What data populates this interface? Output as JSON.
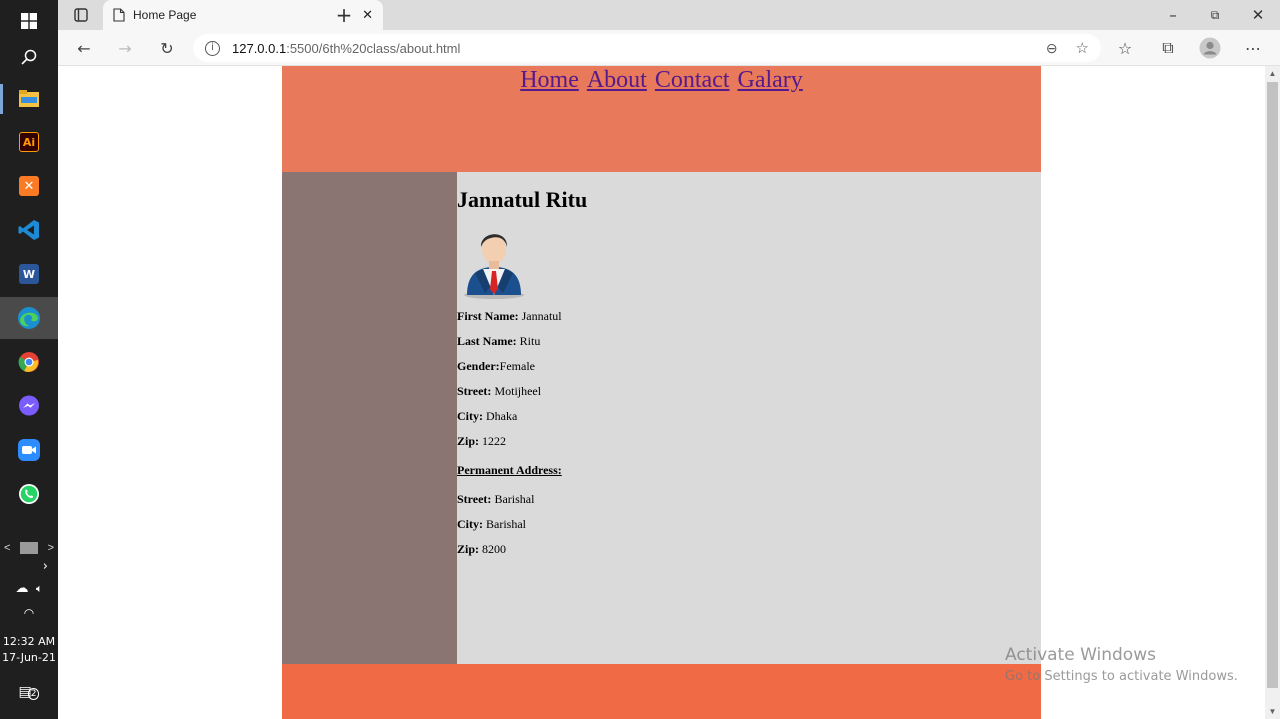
{
  "taskbar": {
    "items": [
      {
        "name": "windows-start",
        "color": "#ffffff"
      },
      {
        "name": "search",
        "color": "#ffffff"
      },
      {
        "name": "file-explorer",
        "color": "#f4c242"
      },
      {
        "name": "adobe-illustrator",
        "label": "Ai",
        "color": "#ff7c00"
      },
      {
        "name": "xampp",
        "color": "#fb7a24"
      },
      {
        "name": "vs-code",
        "color": "#1e8ad6"
      },
      {
        "name": "ms-word",
        "label": "W",
        "color": "#2b579a"
      },
      {
        "name": "edge",
        "color": "#2fa3d9"
      },
      {
        "name": "chrome",
        "color": "#e44134"
      },
      {
        "name": "messenger",
        "color": "#7a5cff"
      },
      {
        "name": "zoom",
        "color": "#2d8cff"
      },
      {
        "name": "whatsapp",
        "color": "#25d366"
      }
    ],
    "clock_time": "12:32 AM",
    "clock_date": "17-Jun-21",
    "notification_count": "2"
  },
  "browser": {
    "tab_title": "Home Page",
    "url_host": "127.0.0.1",
    "url_path": ":5500/6th%20class/about.html"
  },
  "site": {
    "nav": [
      "Home",
      "About",
      "Contact",
      "Galary"
    ],
    "profile_name": "Jannatul Ritu",
    "fields": [
      {
        "label": "First Name:",
        "value": " Jannatul"
      },
      {
        "label": "Last Name:",
        "value": " Ritu"
      },
      {
        "label": "Gender:",
        "value": "Female"
      },
      {
        "label": "Street:",
        "value": " Motijheel"
      },
      {
        "label": "City:",
        "value": " Dhaka"
      },
      {
        "label": "Zip:",
        "value": " 1222"
      }
    ],
    "permanent_heading": "Permanent Address:",
    "permanent_fields": [
      {
        "label": "Street:",
        "value": " Barishal"
      },
      {
        "label": "City:",
        "value": " Barishal"
      },
      {
        "label": "Zip:",
        "value": " 8200"
      }
    ],
    "colors": {
      "header": "#e8795a",
      "sidebar": "#8a7572",
      "main": "#dadada",
      "footer": "#f06b45"
    }
  },
  "watermark": {
    "line1": "Activate Windows",
    "line2": "Go to Settings to activate Windows."
  }
}
